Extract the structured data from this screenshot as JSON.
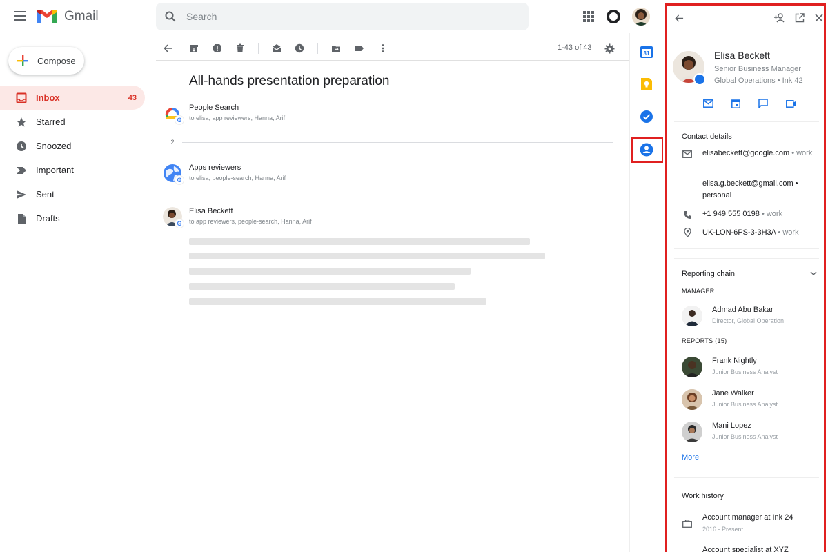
{
  "app": {
    "name": "Gmail"
  },
  "compose": {
    "label": "Compose"
  },
  "nav": {
    "items": [
      {
        "label": "Inbox",
        "count": "43",
        "icon": "inbox-icon",
        "active": true
      },
      {
        "label": "Starred",
        "count": "",
        "icon": "star-icon"
      },
      {
        "label": "Snoozed",
        "count": "",
        "icon": "clock-icon"
      },
      {
        "label": "Important",
        "count": "",
        "icon": "important-icon"
      },
      {
        "label": "Sent",
        "count": "",
        "icon": "send-icon"
      },
      {
        "label": "Drafts",
        "count": "",
        "icon": "draft-icon"
      }
    ]
  },
  "search": {
    "placeholder": "Search"
  },
  "toolbar": {
    "pager": "1-43 of 43"
  },
  "thread": {
    "subject": "All-hands presentation preparation",
    "collapsed_count": "2",
    "messages": [
      {
        "sender": "People Search",
        "to": "to elisa, app reviewers, Hanna, Arif",
        "avatar": "people-search-logo"
      },
      {
        "sender": "Apps reviewers",
        "to": "to elisa, people-search, Hanna, Arif",
        "avatar": "globe-avatar"
      },
      {
        "sender": "Elisa Beckett",
        "to": "to app reviewers, people-search, Hanna, Arif",
        "avatar": "person-avatar"
      }
    ]
  },
  "contact": {
    "name": "Elisa Beckett",
    "title": "Senior Business Manager",
    "org": "Global Operations • Ink 42",
    "details_heading": "Contact details",
    "email_work": "elisabeckett@google.com",
    "email_work_tag": "• work",
    "email_personal": "elisa.g.beckett@gmail.com",
    "email_personal_tag": "• personal",
    "phone": "+1 949 555 0198",
    "phone_tag": "• work",
    "location": "UK-LON-6PS-3-3H3A",
    "location_tag": "• work",
    "reporting_heading": "Reporting chain",
    "manager_label": "MANAGER",
    "manager": {
      "name": "Admad Abu Bakar",
      "role": "Director, Global Operation"
    },
    "reports_label": "REPORTS (15)",
    "reports": [
      {
        "name": "Frank Nightly",
        "role": "Junior Business Analyst"
      },
      {
        "name": "Jane Walker",
        "role": "Junior Business Analyst"
      },
      {
        "name": "Mani Lopez",
        "role": "Junior Business Analyst"
      }
    ],
    "more_label": "More",
    "work_history_heading": "Work history",
    "history": [
      {
        "title": "Account manager at Ink 24",
        "dates": "2016 - Present"
      },
      {
        "title": "Account specialist at XYZ",
        "dates": ""
      }
    ]
  },
  "colors": {
    "accent_red": "#d93025",
    "highlight": "#e02020",
    "link": "#1a73e8",
    "active_bg": "#fce8e6"
  }
}
